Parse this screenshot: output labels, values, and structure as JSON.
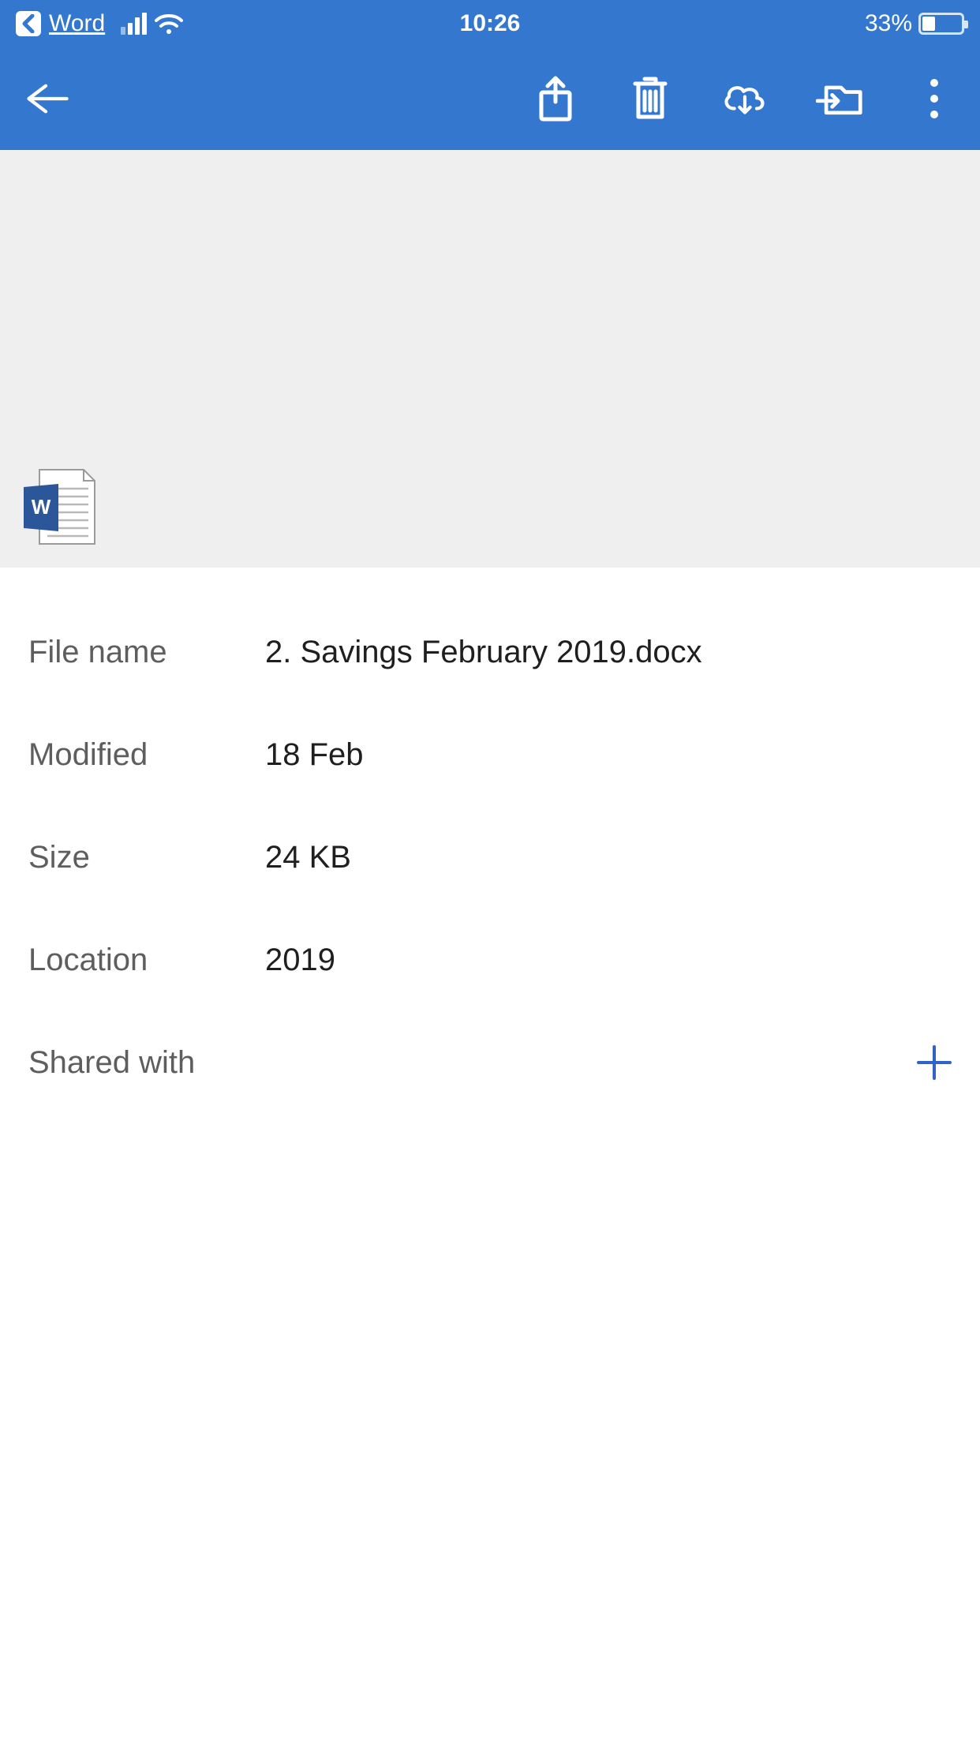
{
  "status_bar": {
    "back_app_label": "Word",
    "time": "10:26",
    "battery_text": "33%"
  },
  "details": {
    "rows": [
      {
        "label": "File name",
        "value": "2. Savings February 2019.docx"
      },
      {
        "label": "Modified",
        "value": "18 Feb"
      },
      {
        "label": "Size",
        "value": "24 KB"
      },
      {
        "label": "Location",
        "value": "2019"
      },
      {
        "label": "Shared with",
        "value": ""
      }
    ]
  },
  "colors": {
    "accent": "#3378CE",
    "plus": "#3063C8"
  }
}
